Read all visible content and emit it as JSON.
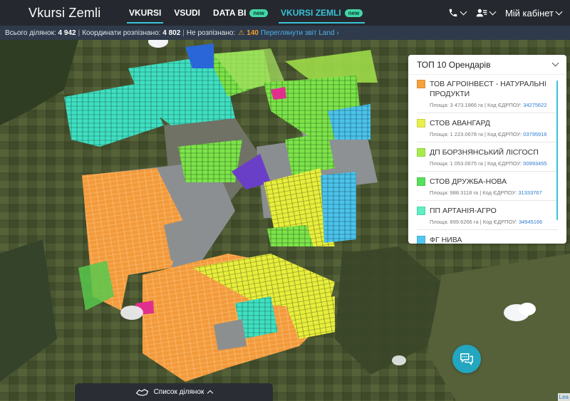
{
  "app": {
    "title": "Vkursi Zemli"
  },
  "nav": {
    "links": [
      {
        "label": "VKURSI",
        "new": false
      },
      {
        "label": "VSUDI",
        "new": false
      },
      {
        "label": "DATA BI",
        "new": true
      },
      {
        "label": "VKURSI ZEMLI",
        "new": true
      }
    ],
    "new_badge": "new",
    "account_label": "Мій кабінет"
  },
  "stats": {
    "total_label": "Всього ділянок:",
    "total_value": "4 942",
    "recognized_label": "Координати розпізнано:",
    "recognized_value": "4 802",
    "unrecognized_label": "Не розпізнано:",
    "unrecognized_value": "140",
    "recheck_link": "Переглянути звіт Land"
  },
  "legend": {
    "title": "ТОП 10 Орендарів",
    "area_label": "Площа:",
    "code_label": "Код ЄДРПОУ:",
    "owners": [
      {
        "name": "ТОВ АГРОІНВЕСТ - НАТУРАЛЬНІ ПРОДУКТИ",
        "area": "3 473.1866 га",
        "code": "34275622",
        "color": "#f5a13c"
      },
      {
        "name": "СТОВ АВАНГАРД",
        "area": "1 223.0678 га",
        "code": "03795916",
        "color": "#e8f04a"
      },
      {
        "name": "ДП БОРЗНЯНСЬКИЙ ЛІСГОСП",
        "area": "1 053.0675 га",
        "code": "00993455",
        "color": "#a8ec4c"
      },
      {
        "name": "СТОВ ДРУЖБА-НОВА",
        "area": "988.3118 га",
        "code": "31333767",
        "color": "#58e05c"
      },
      {
        "name": "ПП АРТАНІЯ-АГРО",
        "area": "899.6266 га",
        "code": "34945166",
        "color": "#5ef0c4"
      },
      {
        "name": "ФГ НИВА",
        "area": "",
        "code": "",
        "color": "#52c6ee"
      }
    ]
  },
  "bottom": {
    "list_label": "Список ділянок"
  },
  "attribution": "Lea"
}
